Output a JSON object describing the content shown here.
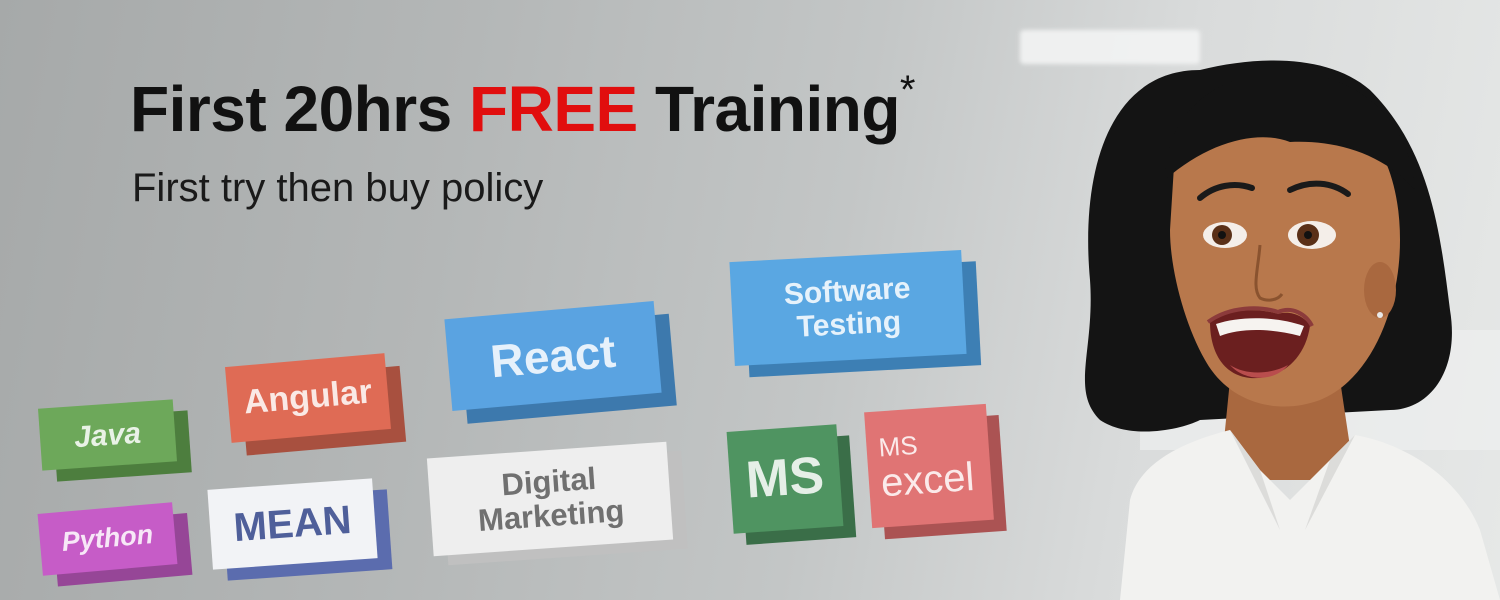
{
  "headline": {
    "part1": "First 20hrs",
    "highlight": "FREE",
    "part2": "Training",
    "asterisk": "*"
  },
  "subheadline": "First try then buy policy",
  "bricks": {
    "java": "Java",
    "python": "Python",
    "angular": "Angular",
    "mean": "MEAN",
    "react": "React",
    "digital_marketing": [
      "Digital",
      "Marketing"
    ],
    "software_testing": [
      "Software",
      "Testing"
    ],
    "ms": "MS",
    "ms_excel": [
      "MS",
      "excel"
    ]
  },
  "colors": {
    "highlight": "#e10e0e",
    "java": "#6da85a",
    "python": "#c65cc7",
    "angular": "#df6b55",
    "mean": "#5b6cae",
    "react": "#5aa3e1",
    "software_testing": "#5aa7e2",
    "ms": "#4f9461",
    "ms_excel": "#e07474"
  }
}
